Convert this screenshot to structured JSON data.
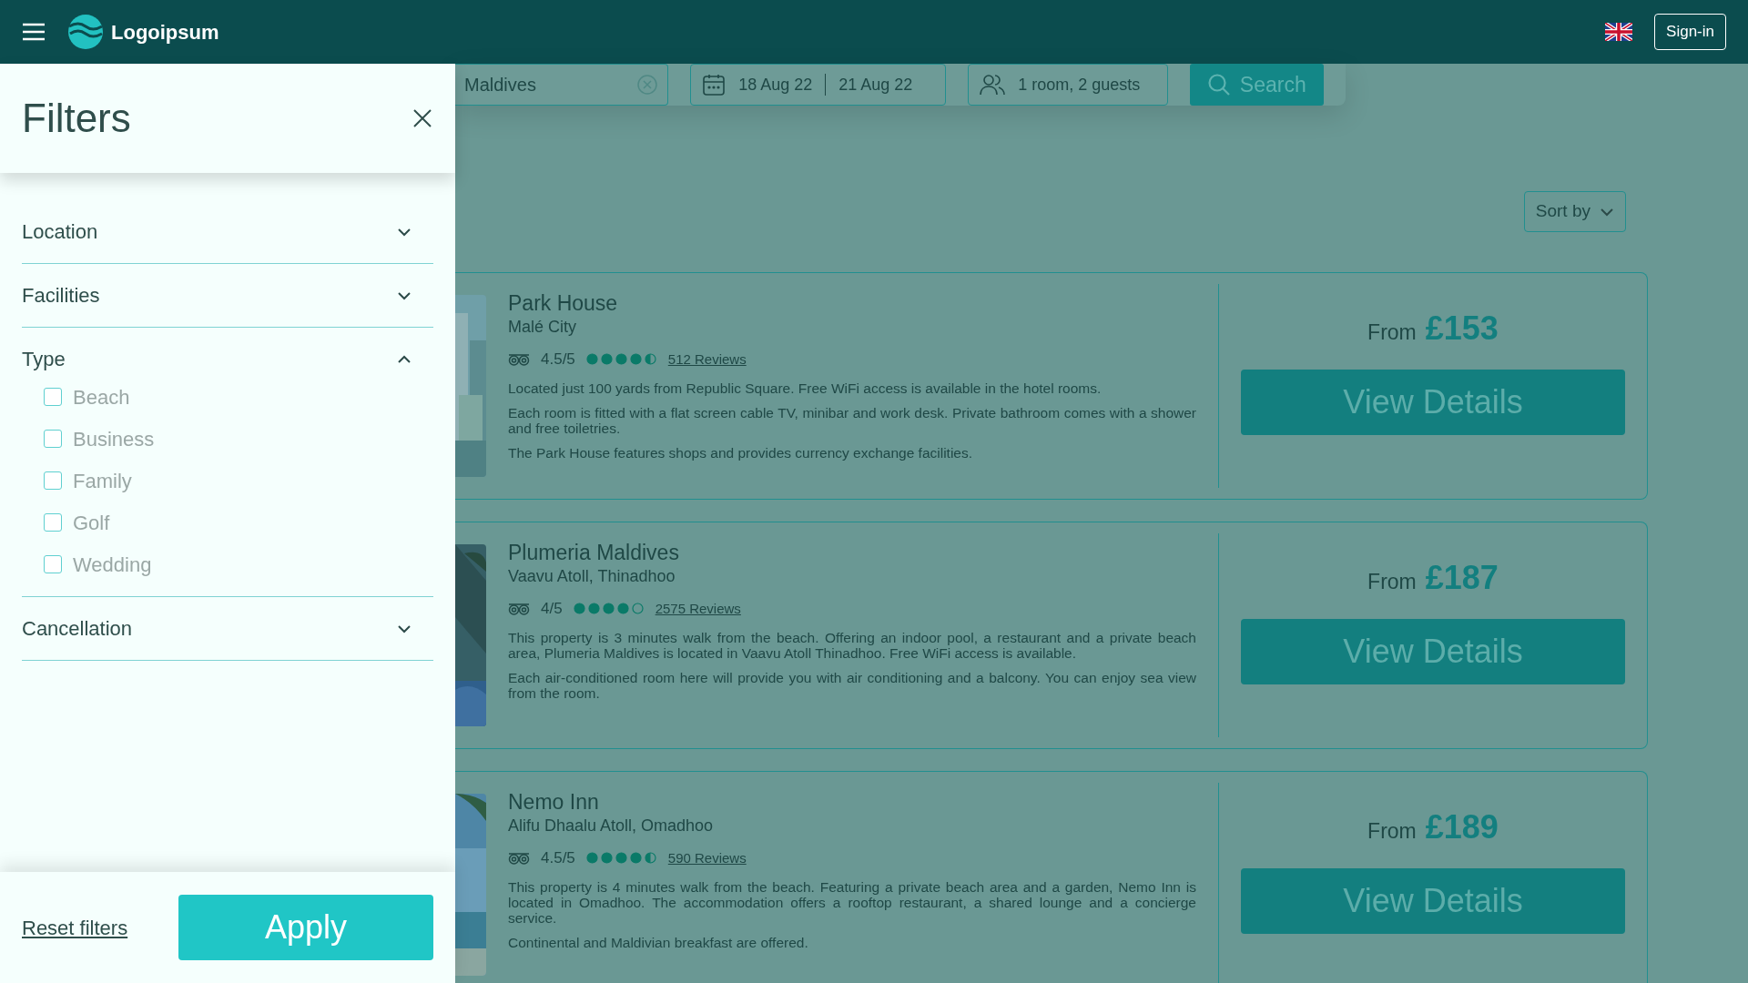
{
  "header": {
    "logo_text": "Logoipsum",
    "sign_in": "Sign-in"
  },
  "search": {
    "location": "Maldives",
    "check_in": "18 Aug 22",
    "check_out": "21 Aug 22",
    "guests": "1 room, 2 guests",
    "button": "Search"
  },
  "sort": {
    "label": "Sort by"
  },
  "hotels": [
    {
      "name": "Park House",
      "location": "Malé City",
      "rating": "4.5/5",
      "stars": 4.5,
      "reviews": "512 Reviews",
      "paragraphs": [
        "Located just 100 yards from Republic Square. Free WiFi access is available in the hotel rooms.",
        "Each room is fitted with a flat screen cable TV, minibar and work desk. Private bathroom comes with a shower and free toiletries.",
        "The Park House features shops and provides currency exchange facilities."
      ],
      "from": "From",
      "price": "£153",
      "button": "View Details"
    },
    {
      "name": "Plumeria Maldives",
      "location": "Vaavu Atoll, Thinadhoo",
      "rating": "4/5",
      "stars": 4,
      "reviews": "2575 Reviews",
      "paragraphs": [
        "This property is 3 minutes walk from the beach. Offering an indoor pool, a restaurant and a private beach area, Plumeria Maldives is located in Vaavu Atoll Thinadhoo. Free WiFi access is available.",
        "Each air-conditioned room here will provide you with air conditioning and a balcony. You can enjoy sea view from the room."
      ],
      "from": "From",
      "price": "£187",
      "button": "View Details"
    },
    {
      "name": "Nemo Inn",
      "location": "Alifu Dhaalu Atoll, Omadhoo",
      "rating": "4.5/5",
      "stars": 4.5,
      "reviews": "590 Reviews",
      "paragraphs": [
        "This property is 4 minutes walk from the beach. Featuring a private beach area and a garden, Nemo Inn is located in Omadhoo. The accommodation offers a rooftop restaurant, a shared lounge and a concierge service.",
        "Continental and Maldivian breakfast are offered."
      ],
      "from": "From",
      "price": "£189",
      "button": "View Details"
    }
  ],
  "filters": {
    "title": "Filters",
    "sections": [
      {
        "label": "Location",
        "expanded": false
      },
      {
        "label": "Facilities",
        "expanded": false
      },
      {
        "label": "Type",
        "expanded": true,
        "options": [
          {
            "label": "Beach",
            "checked": false
          },
          {
            "label": "Business",
            "checked": false
          },
          {
            "label": "Family",
            "checked": false
          },
          {
            "label": "Golf",
            "checked": false
          },
          {
            "label": "Wedding",
            "checked": false
          }
        ]
      },
      {
        "label": "Cancellation",
        "expanded": false
      }
    ],
    "reset": "Reset filters",
    "apply": "Apply"
  }
}
